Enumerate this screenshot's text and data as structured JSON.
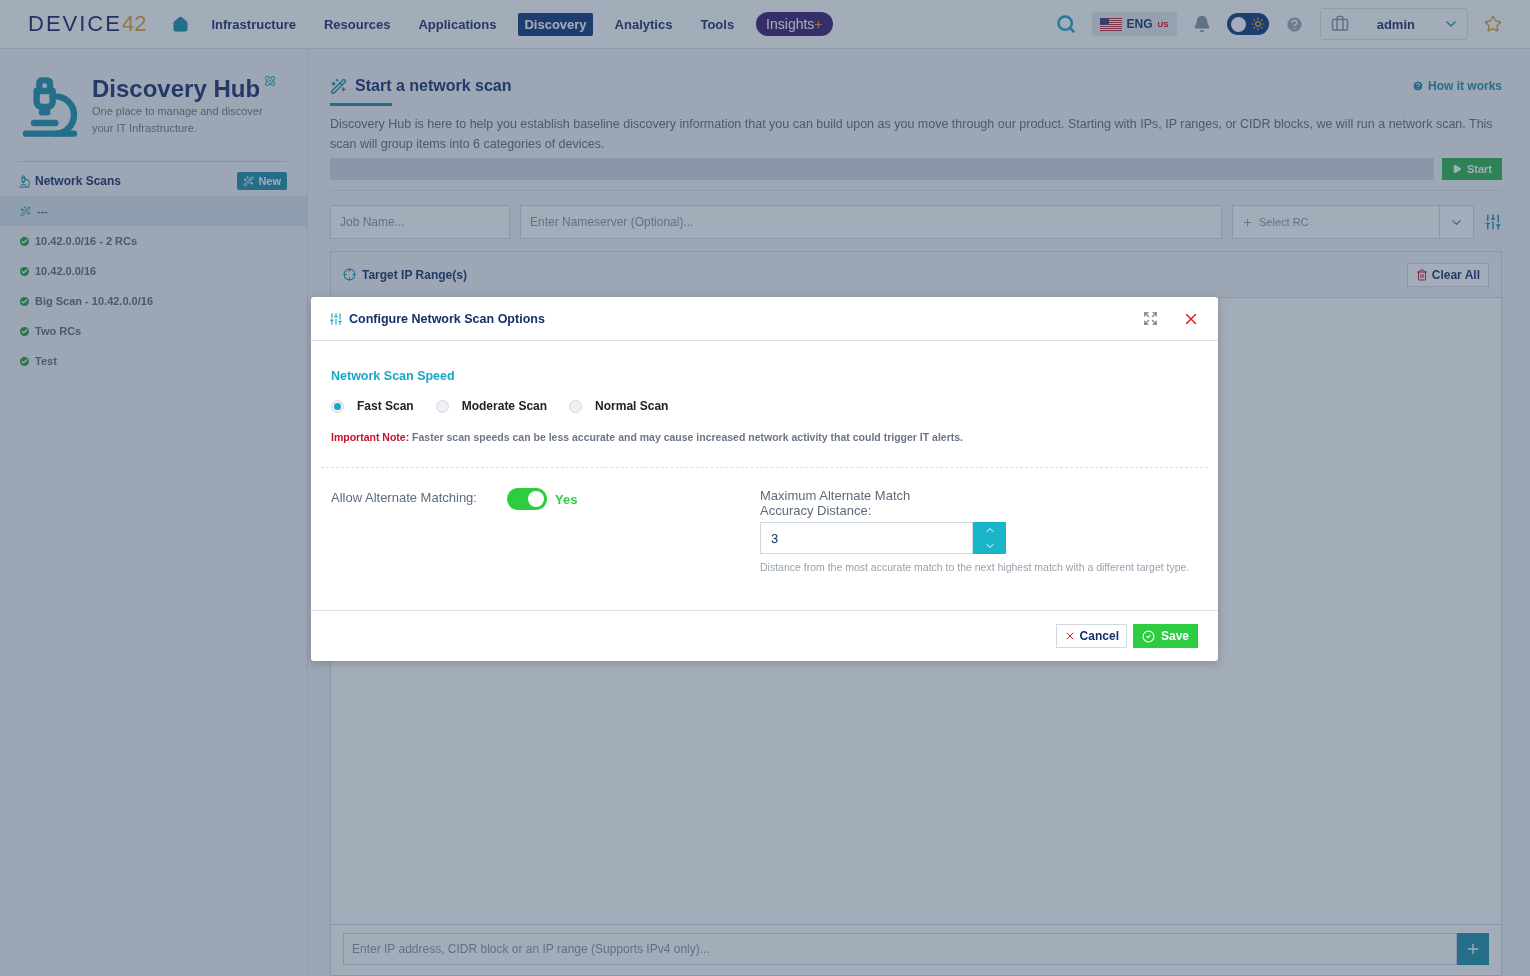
{
  "topbar": {
    "logo": {
      "word": "DEVICE",
      "number": "42"
    },
    "nav": [
      {
        "label": "Infrastructure",
        "selected": false
      },
      {
        "label": "Resources",
        "selected": false
      },
      {
        "label": "Applications",
        "selected": false
      },
      {
        "label": "Discovery",
        "selected": true
      },
      {
        "label": "Analytics",
        "selected": false
      },
      {
        "label": "Tools",
        "selected": false
      }
    ],
    "insights": {
      "label": "Insights",
      "plus": "+"
    },
    "language": {
      "code": "ENG",
      "region": "US"
    },
    "theme_toggle": {
      "on": false
    },
    "user": "admin"
  },
  "sidebar": {
    "title": "Discovery Hub",
    "subtitle": "One place to manage and discover your IT Infrastructure.",
    "section": "Network Scans",
    "new_button": "New",
    "scans": [
      {
        "label": "---",
        "kind": "draft",
        "selected": true
      },
      {
        "label": "10.42.0.0/16 - 2 RCs",
        "kind": "done",
        "selected": false
      },
      {
        "label": "10.42.0.0/16",
        "kind": "done",
        "selected": false
      },
      {
        "label": "Big Scan - 10.42.0.0/16",
        "kind": "done",
        "selected": false
      },
      {
        "label": "Two RCs",
        "kind": "done",
        "selected": false
      },
      {
        "label": "Test",
        "kind": "done",
        "selected": false
      }
    ]
  },
  "main": {
    "title": "Start a network scan",
    "help_link": "How it works",
    "description": "Discovery Hub is here to help you establish baseline discovery information that you can build upon as you move through our product. Starting with IPs, IP ranges, or CIDR blocks, we will run a network scan. This scan will group items into 6 categories of devices.",
    "progress": {
      "level": 0
    },
    "start_button": "Start",
    "job_name": {
      "placeholder": "Job Name..."
    },
    "nameserver": {
      "placeholder": "Enter Nameserver (Optional)..."
    },
    "rc_select": {
      "placeholder": "Select RC"
    },
    "targets": {
      "title": "Target IP Range(s)",
      "clear_button": "Clear All",
      "ip_input": {
        "placeholder": "Enter IP address, CIDR block or an IP range (Supports IPv4 only)..."
      }
    }
  },
  "modal": {
    "title": "Configure Network Scan Options",
    "speed_heading": "Network Scan Speed",
    "speeds": [
      {
        "label": "Fast Scan",
        "selected": true
      },
      {
        "label": "Moderate Scan",
        "selected": false
      },
      {
        "label": "Normal Scan",
        "selected": false
      }
    ],
    "note": {
      "label": "Important Note:",
      "text": "Faster scan speeds can be less accurate and may cause increased network activity that could trigger IT alerts."
    },
    "alternate": {
      "label": "Allow Alternate Matching:",
      "on": true,
      "state_label": "Yes"
    },
    "distance": {
      "label": "Maximum Alternate Match Accuracy Distance:",
      "value": "3",
      "help": "Distance from the most accurate match to the next highest match with a different target type."
    },
    "cancel_button": "Cancel",
    "save_button": "Save"
  }
}
